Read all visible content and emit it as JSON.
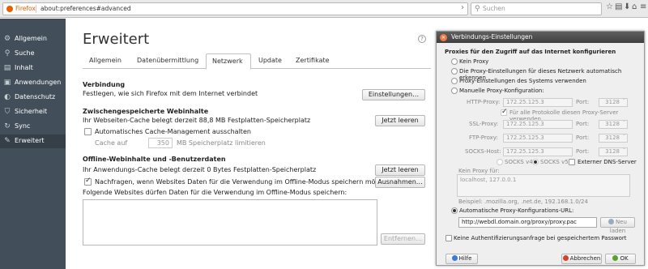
{
  "toolbar": {
    "browser_name": "Firefox",
    "url": "about:preferences#advanced",
    "search_placeholder": "Suchen",
    "icons": [
      "star-icon",
      "bookmarks-icon",
      "download-icon",
      "home-icon",
      "menu-icon"
    ]
  },
  "sidebar": {
    "items": [
      {
        "label": "Allgemein",
        "icon": "general-icon"
      },
      {
        "label": "Suche",
        "icon": "search-icon"
      },
      {
        "label": "Inhalt",
        "icon": "content-icon"
      },
      {
        "label": "Anwendungen",
        "icon": "applications-icon"
      },
      {
        "label": "Datenschutz",
        "icon": "privacy-icon"
      },
      {
        "label": "Sicherheit",
        "icon": "security-icon"
      },
      {
        "label": "Sync",
        "icon": "sync-icon"
      },
      {
        "label": "Erweitert",
        "icon": "advanced-icon",
        "active": true
      }
    ]
  },
  "main": {
    "title": "Erweitert",
    "tabs": [
      "Allgemein",
      "Datenübermittlung",
      "Netzwerk",
      "Update",
      "Zertifikate"
    ],
    "active_tab": "Netzwerk",
    "connection": {
      "heading": "Verbindung",
      "description": "Festlegen, wie sich Firefox mit dem Internet verbindet",
      "settings_button": "Einstellungen…"
    },
    "cache": {
      "heading": "Zwischengespeicherte Webinhalte",
      "description": "Ihr Webseiten-Cache belegt derzeit 88,8 MB Festplatten-Speicherplatz",
      "clear_button": "Jetzt leeren",
      "auto_manage_label": "Automatisches Cache-Management ausschalten",
      "auto_manage_checked": false,
      "limit_prefix": "Cache auf",
      "limit_value": "350",
      "limit_suffix": "MB Speicherplatz limitieren"
    },
    "offline": {
      "heading": "Offline-Webinhalte und -Benutzerdaten",
      "description": "Ihr Anwendungs-Cache belegt derzeit 0 Bytes Festplatten-Speicherplatz",
      "clear_button": "Jetzt leeren",
      "notify_label": "Nachfragen, wenn Websites Daten für die Verwendung im Offline-Modus speichern möchten.",
      "notify_checked": true,
      "exceptions_button": "Ausnahmen…",
      "sites_label": "Folgende Websites dürfen Daten für die Verwendung im Offline-Modus speichern:",
      "remove_button": "Entfernen…"
    }
  },
  "dialog": {
    "title": "Verbindungs-Einstellungen",
    "heading": "Proxies für den Zugriff auf das Internet konfigurieren",
    "options": [
      "Kein Proxy",
      "Die Proxy-Einstellungen für dieses Netzwerk automatisch erkennen",
      "Proxy-Einstellungen des Systems verwenden",
      "Manuelle Proxy-Konfiguration:"
    ],
    "selected_option": "Automatische Proxy-Konfigurations-URL:",
    "http_label": "HTTP-Proxy:",
    "http_value": "172.25.125.3",
    "port_label": "Port:",
    "http_port": "3128",
    "all_protocols_label": "Für alle Protokolle diesen Proxy-Server verwenden",
    "ssl_label": "SSL-Proxy:",
    "ssl_value": "172.25.125.3",
    "ssl_port": "3128",
    "ftp_label": "FTP-Proxy:",
    "ftp_value": "172.25.125.3",
    "ftp_port": "3128",
    "socks_label": "SOCKS-Host:",
    "socks_value": "172.25.125.3",
    "socks_port": "3128",
    "socks4_label": "SOCKS v4",
    "socks5_label": "SOCKS v5",
    "remote_dns_label": "Externer DNS-Server",
    "no_proxy_label": "Kein Proxy für:",
    "no_proxy_value": "localhost, 127.0.0.1",
    "example_text": "Beispiel: .mozilla.org, .net.de, 192.168.1.0/24",
    "auto_url_label": "Automatische Proxy-Konfigurations-URL:",
    "auto_url_value": "http://webdl.domain.org/proxy/proxy.pac",
    "reload_button": "Neu laden",
    "no_auth_label": "Keine Authentifizierungsanfrage bei gespeichertem Passwort",
    "help_button": "Hilfe",
    "cancel_button": "Abbrechen",
    "ok_button": "OK"
  }
}
